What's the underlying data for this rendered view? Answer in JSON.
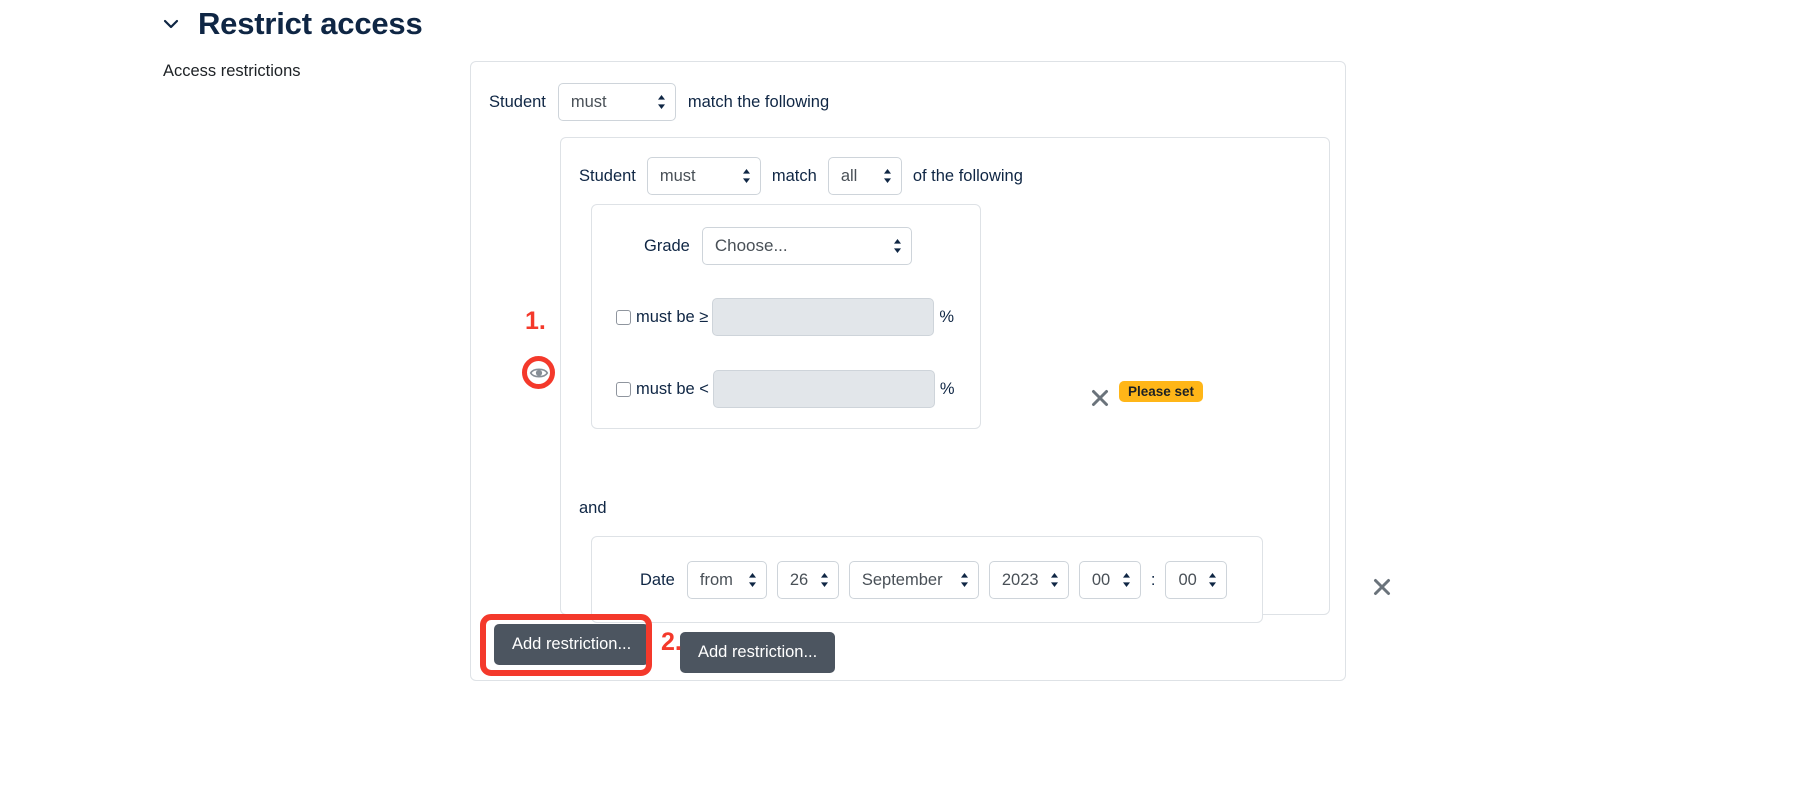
{
  "section": {
    "title": "Restrict access",
    "collapse_icon": "chevron-down-icon",
    "field_label": "Access restrictions"
  },
  "top_condition": {
    "subject_label": "Student",
    "operator_value": "must",
    "suffix_label": "match the following"
  },
  "group_condition": {
    "subject_label": "Student",
    "operator_value": "must",
    "match_label": "match",
    "quantifier_value": "all",
    "suffix_label": "of the following"
  },
  "grade_condition": {
    "label": "Grade",
    "select_value": "Choose...",
    "min_rule": {
      "text": "must be ≥",
      "value": "",
      "unit": "%"
    },
    "max_rule": {
      "text": "must be <",
      "value": "",
      "unit": "%"
    },
    "delete_icon": "close-icon",
    "badge": "Please set",
    "badge_color": "#ffb618"
  },
  "operator_between": "and",
  "date_condition": {
    "label": "Date",
    "direction_value": "from",
    "day_value": "26",
    "month_value": "September",
    "year_value": "2023",
    "hour_value": "00",
    "time_separator": ":",
    "minute_value": "00",
    "delete_icon": "close-icon"
  },
  "buttons": {
    "add_restriction_inner": "Add restriction...",
    "add_restriction_outer": "Add restriction..."
  },
  "annotations": {
    "step_one": "1.",
    "step_two": "2.",
    "eye_icon": "eye-visible-icon",
    "highlight_color": "#f4392b"
  }
}
